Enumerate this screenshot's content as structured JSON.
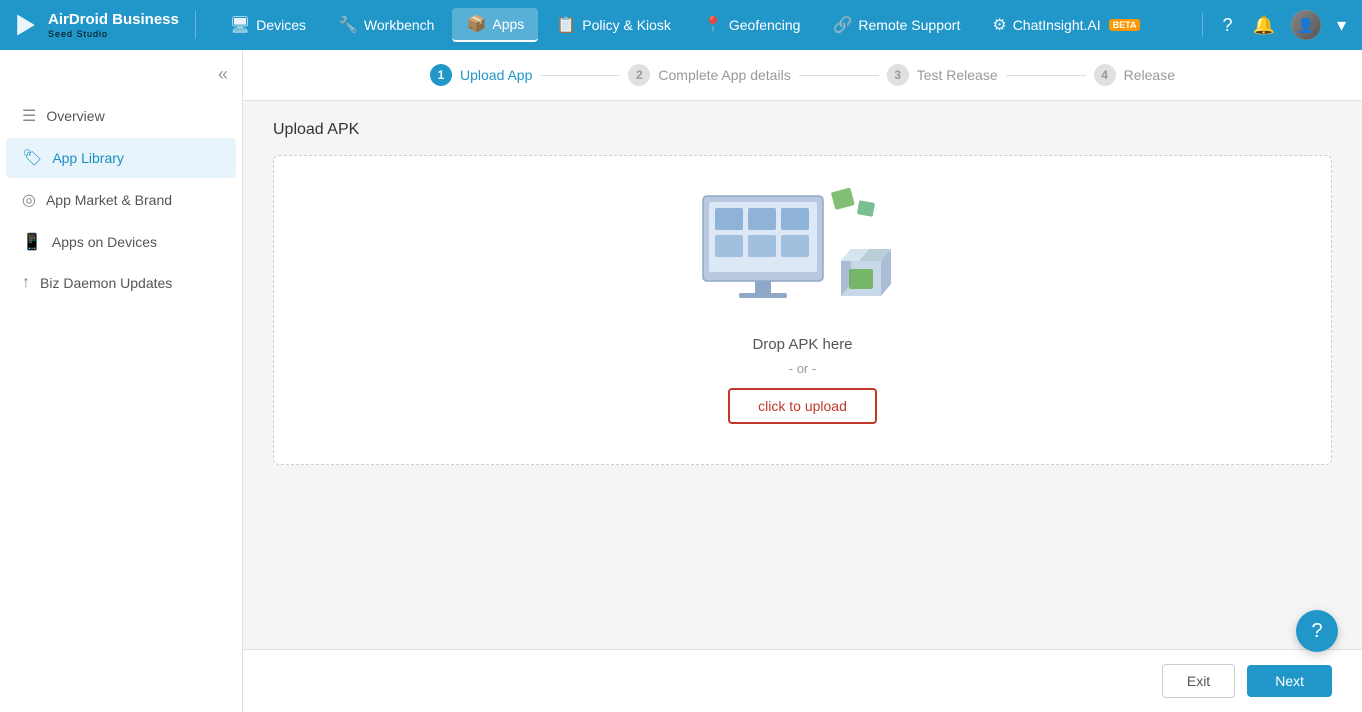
{
  "app": {
    "name": "AirDroid Business",
    "sub_name": "Seed Studio",
    "logo_symbol": "◄"
  },
  "nav": {
    "items": [
      {
        "id": "devices",
        "label": "Devices",
        "icon": "🖥",
        "active": false
      },
      {
        "id": "workbench",
        "label": "Workbench",
        "icon": "🔧",
        "active": false
      },
      {
        "id": "apps",
        "label": "Apps",
        "icon": "📦",
        "active": true
      },
      {
        "id": "policy",
        "label": "Policy & Kiosk",
        "icon": "📋",
        "active": false
      },
      {
        "id": "geofencing",
        "label": "Geofencing",
        "icon": "📍",
        "active": false
      },
      {
        "id": "remote-support",
        "label": "Remote Support",
        "icon": "🔗",
        "active": false
      },
      {
        "id": "chatinsight",
        "label": "ChatInsight.AI",
        "icon": "⚙",
        "active": false,
        "beta": true
      }
    ],
    "right_icons": [
      "?",
      "🔔"
    ]
  },
  "sidebar": {
    "items": [
      {
        "id": "overview",
        "label": "Overview",
        "icon": "≡",
        "active": false
      },
      {
        "id": "app-library",
        "label": "App Library",
        "icon": "🏷",
        "active": true
      },
      {
        "id": "app-market",
        "label": "App Market & Brand",
        "icon": "◎",
        "active": false
      },
      {
        "id": "apps-on-devices",
        "label": "Apps on Devices",
        "icon": "📱",
        "active": false
      },
      {
        "id": "biz-daemon",
        "label": "Biz Daemon Updates",
        "icon": "↑",
        "active": false
      }
    ]
  },
  "stepper": {
    "steps": [
      {
        "num": "1",
        "label": "Upload App",
        "active": true
      },
      {
        "num": "2",
        "label": "Complete App details",
        "active": false
      },
      {
        "num": "3",
        "label": "Test Release",
        "active": false
      },
      {
        "num": "4",
        "label": "Release",
        "active": false
      }
    ]
  },
  "upload": {
    "title": "Upload APK",
    "drop_text": "Drop APK here",
    "or_text": "- or -",
    "button_label": "click to upload"
  },
  "footer": {
    "exit_label": "Exit",
    "next_label": "Next"
  },
  "help": {
    "icon": "?"
  }
}
